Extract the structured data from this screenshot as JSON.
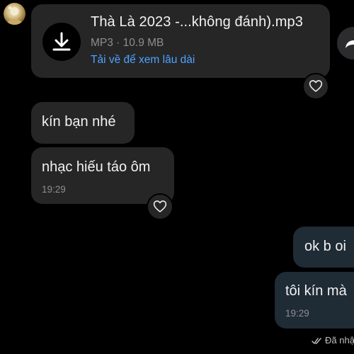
{
  "file_message": {
    "file_name": "Thà Là 2023 -...không đánh).mp3",
    "file_meta": "MP3 · 10.9 MB",
    "download_link": "Tải về để xem lâu dài"
  },
  "messages_in": [
    {
      "text": "kín bạn nhé"
    },
    {
      "text": "nhạc hiếu táo ôm",
      "time": "19:29"
    }
  ],
  "messages_out": [
    {
      "text": "ok b oi"
    },
    {
      "text": "tôi kín mà",
      "time": "19:29"
    }
  ],
  "status": {
    "read_label": "Đã nhậ"
  },
  "icons": {
    "download": "download-icon",
    "share": "share-icon",
    "reaction": "heart-icon",
    "read": "double-check-icon"
  },
  "colors": {
    "background": "#000000",
    "incoming_bubble": "#262626",
    "outgoing_bubble": "#1f2b35",
    "link": "#4da3ff",
    "meta": "#8e8e93"
  }
}
